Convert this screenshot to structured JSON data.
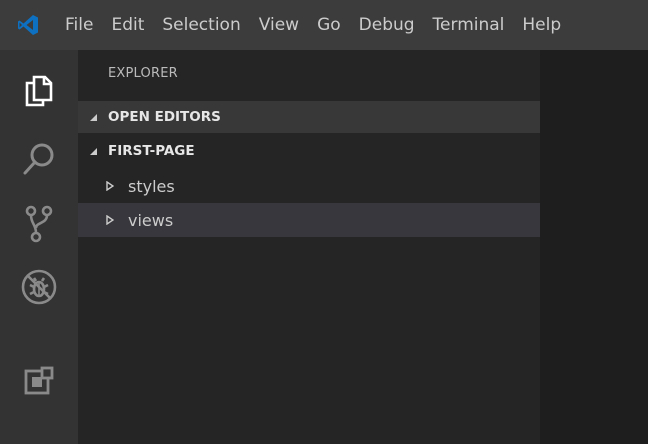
{
  "menubar": {
    "logo_icon": "vscode-logo-icon",
    "items": [
      {
        "label": "File"
      },
      {
        "label": "Edit"
      },
      {
        "label": "Selection"
      },
      {
        "label": "View"
      },
      {
        "label": "Go"
      },
      {
        "label": "Debug"
      },
      {
        "label": "Terminal"
      },
      {
        "label": "Help"
      }
    ]
  },
  "activitybar": {
    "icons": [
      "files-icon",
      "search-icon",
      "source-control-icon",
      "debug-icon",
      "extensions-icon"
    ],
    "active": "files-icon"
  },
  "sidebar": {
    "title": "EXPLORER",
    "sections": [
      {
        "label": "OPEN EDITORS",
        "expanded": true
      },
      {
        "label": "FIRST-PAGE",
        "expanded": true
      }
    ],
    "tree": [
      {
        "label": "styles",
        "expanded": false,
        "selected": false
      },
      {
        "label": "views",
        "expanded": false,
        "selected": true
      }
    ]
  },
  "colors": {
    "menubar_bg": "#3c3c3c",
    "activitybar_bg": "#333333",
    "sidebar_bg": "#252526",
    "editor_bg": "#1e1e1e",
    "selection_bg": "#37373d",
    "accent": "#0e70c0"
  }
}
